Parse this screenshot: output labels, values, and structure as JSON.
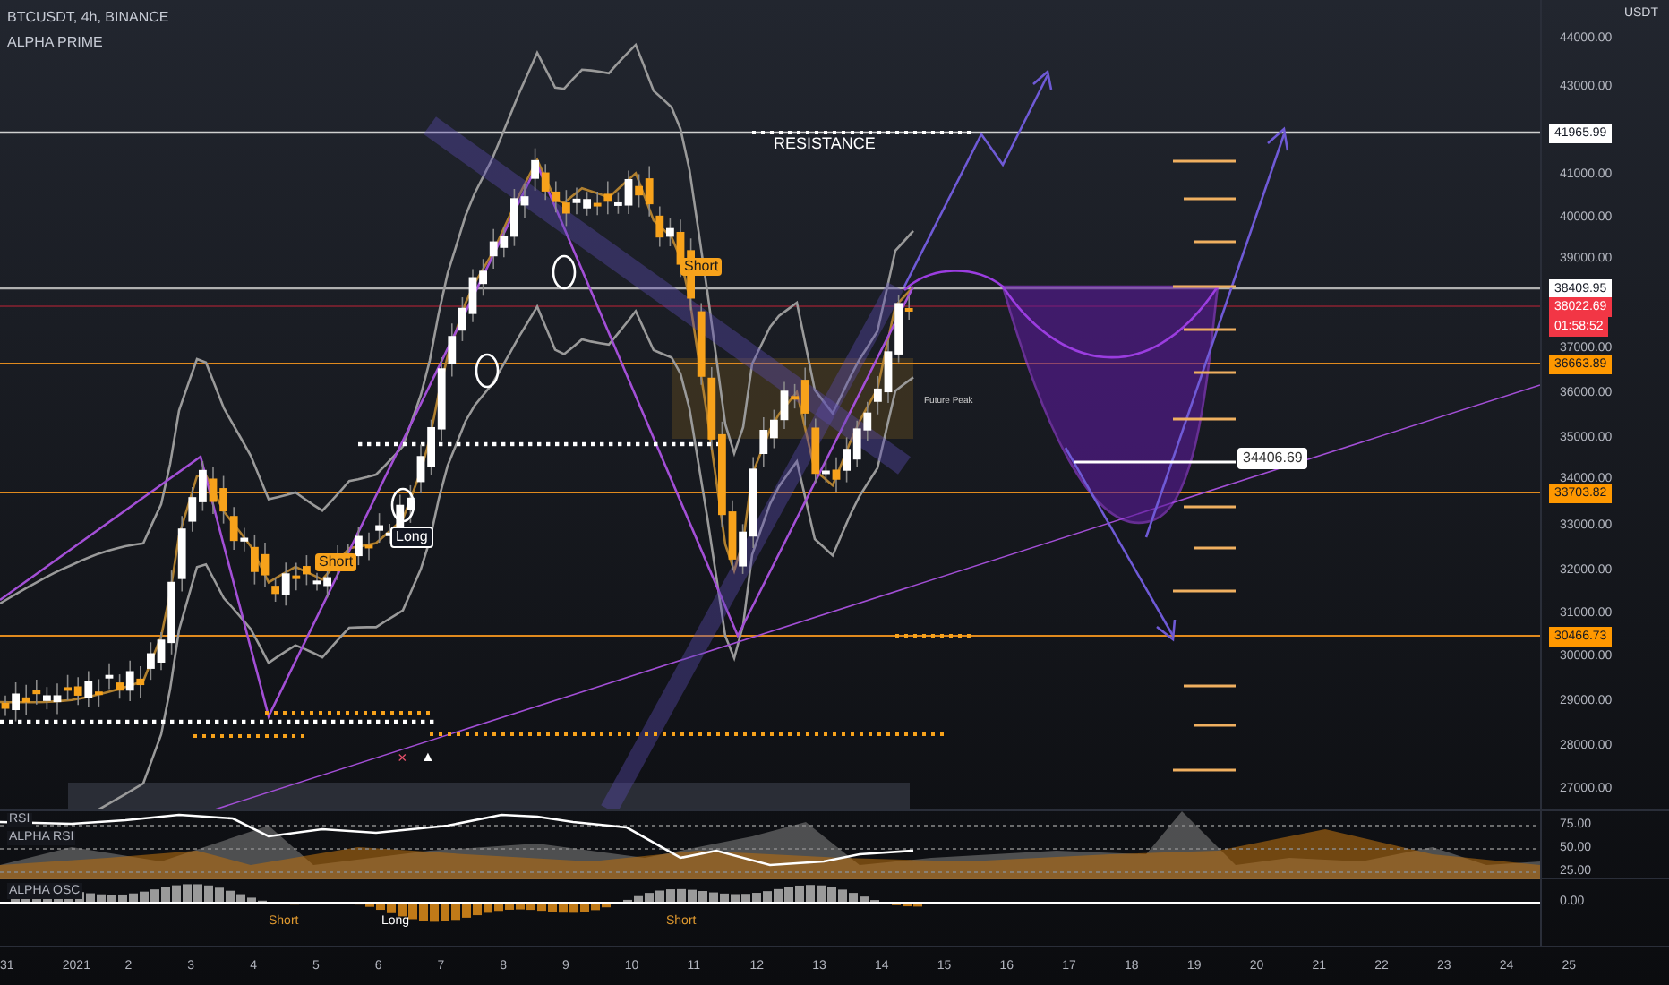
{
  "header": {
    "symbol": "BTCUSDT, 4h, BINANCE",
    "indicator": "ALPHA PRIME"
  },
  "chart_labels": [
    {
      "kind": "plain",
      "text": "RESISTANCE"
    },
    {
      "kind": "tag",
      "text": "Short"
    },
    {
      "kind": "tag",
      "text": "Short"
    },
    {
      "kind": "outline",
      "text": "Long"
    },
    {
      "kind": "tiny",
      "text": "Future Peak"
    },
    {
      "kind": "price",
      "text": "34406.69"
    }
  ],
  "markers": [
    "×",
    "▲"
  ],
  "price_axis": {
    "unit": "USDT",
    "labels": [
      "44000.00",
      "43000.00",
      "41000.00",
      "40000.00",
      "39000.00",
      "37000.00",
      "36000.00",
      "35000.00",
      "34000.00",
      "33000.00",
      "32000.00",
      "31000.00",
      "30000.00",
      "29000.00",
      "28000.00",
      "27000.00"
    ],
    "tags": [
      {
        "text": "41965.99",
        "color": "#ffffff"
      },
      {
        "text": "38409.95",
        "color": "#ffffff"
      },
      {
        "text": "38022.69",
        "color": "#f23645"
      },
      {
        "text": "01:58:52",
        "color": "#f23645"
      },
      {
        "text": "36663.89",
        "color": "#ff9800"
      },
      {
        "text": "33703.82",
        "color": "#ff9800"
      },
      {
        "text": "30466.73",
        "color": "#ff9800"
      }
    ]
  },
  "panes": [
    {
      "labels": [
        "RSI",
        "ALPHA RSI"
      ],
      "levels": [
        "75.00",
        "50.00",
        "25.00"
      ]
    },
    {
      "labels": [
        "ALPHA OSC"
      ],
      "levels": [
        "0.00"
      ],
      "signals": [
        "Short",
        "Long",
        "Short"
      ]
    }
  ],
  "time_axis": [
    "31",
    "2021",
    "2",
    "3",
    "4",
    "5",
    "6",
    "7",
    "8",
    "9",
    "10",
    "11",
    "12",
    "13",
    "14",
    "15",
    "16",
    "17",
    "18",
    "19",
    "20",
    "21",
    "22",
    "23",
    "24",
    "25"
  ]
}
